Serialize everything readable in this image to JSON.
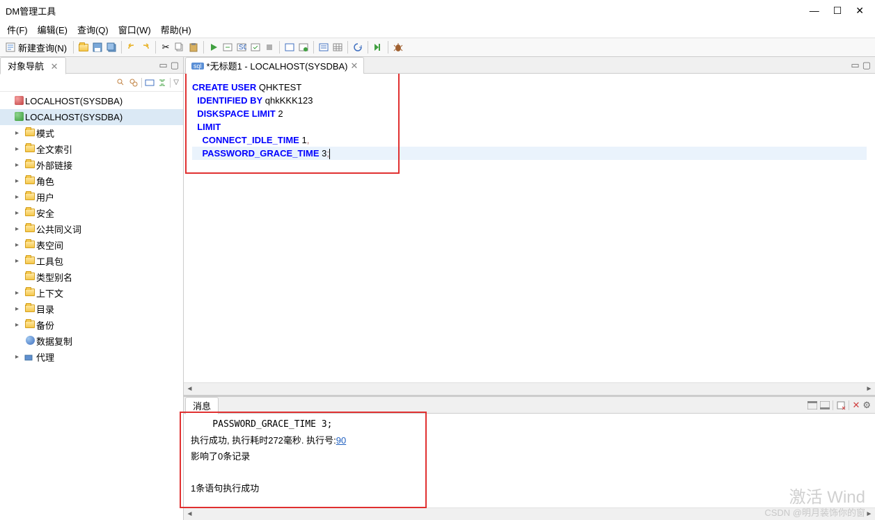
{
  "app": {
    "title": "DM管理工具"
  },
  "menu": {
    "file": "件(F)",
    "edit": "编辑(E)",
    "query": "查询(Q)",
    "window": "窗口(W)",
    "help": "帮助(H)"
  },
  "toolbar": {
    "new_query": "新建查询(N)"
  },
  "sidebar": {
    "title": "对象导航",
    "connections": [
      {
        "label": "LOCALHOST(SYSDBA)"
      },
      {
        "label": "LOCALHOST(SYSDBA)"
      }
    ],
    "items": [
      {
        "label": "模式"
      },
      {
        "label": "全文索引"
      },
      {
        "label": "外部链接"
      },
      {
        "label": "角色"
      },
      {
        "label": "用户"
      },
      {
        "label": "安全"
      },
      {
        "label": "公共同义词"
      },
      {
        "label": "表空间"
      },
      {
        "label": "工具包"
      },
      {
        "label": "类型别名"
      },
      {
        "label": "上下文"
      },
      {
        "label": "目录"
      },
      {
        "label": "备份"
      },
      {
        "label": "数据复制"
      },
      {
        "label": "代理"
      }
    ]
  },
  "editor": {
    "tab_title": "*无标题1 - LOCALHOST(SYSDBA)",
    "code": {
      "l1_kw1": "CREATE",
      "l1_kw2": "USER",
      "l1_id": "QHKTEST",
      "l2_kw1": "IDENTIFIED",
      "l2_kw2": "BY",
      "l2_id": "qhkKKK123",
      "l3_kw1": "DISKSPACE",
      "l3_kw2": "LIMIT",
      "l3_v": "2",
      "l4_kw": "LIMIT",
      "l5_kw": "CONNECT_IDLE_TIME",
      "l5_v": "1",
      "l5_p": ",",
      "l6_kw": "PASSWORD_GRACE_TIME",
      "l6_v": "3",
      "l6_p": ";"
    }
  },
  "messages": {
    "tab": "消息",
    "line1": "    PASSWORD_GRACE_TIME 3;",
    "line2a": "执行成功, 执行耗时272毫秒. 执行号:",
    "line2b": "90",
    "line3": "影响了0条记录",
    "line4": "1条语句执行成功"
  },
  "watermark": {
    "main": "激活 Wind",
    "sub": "CSDN @明月装饰你的窗"
  }
}
